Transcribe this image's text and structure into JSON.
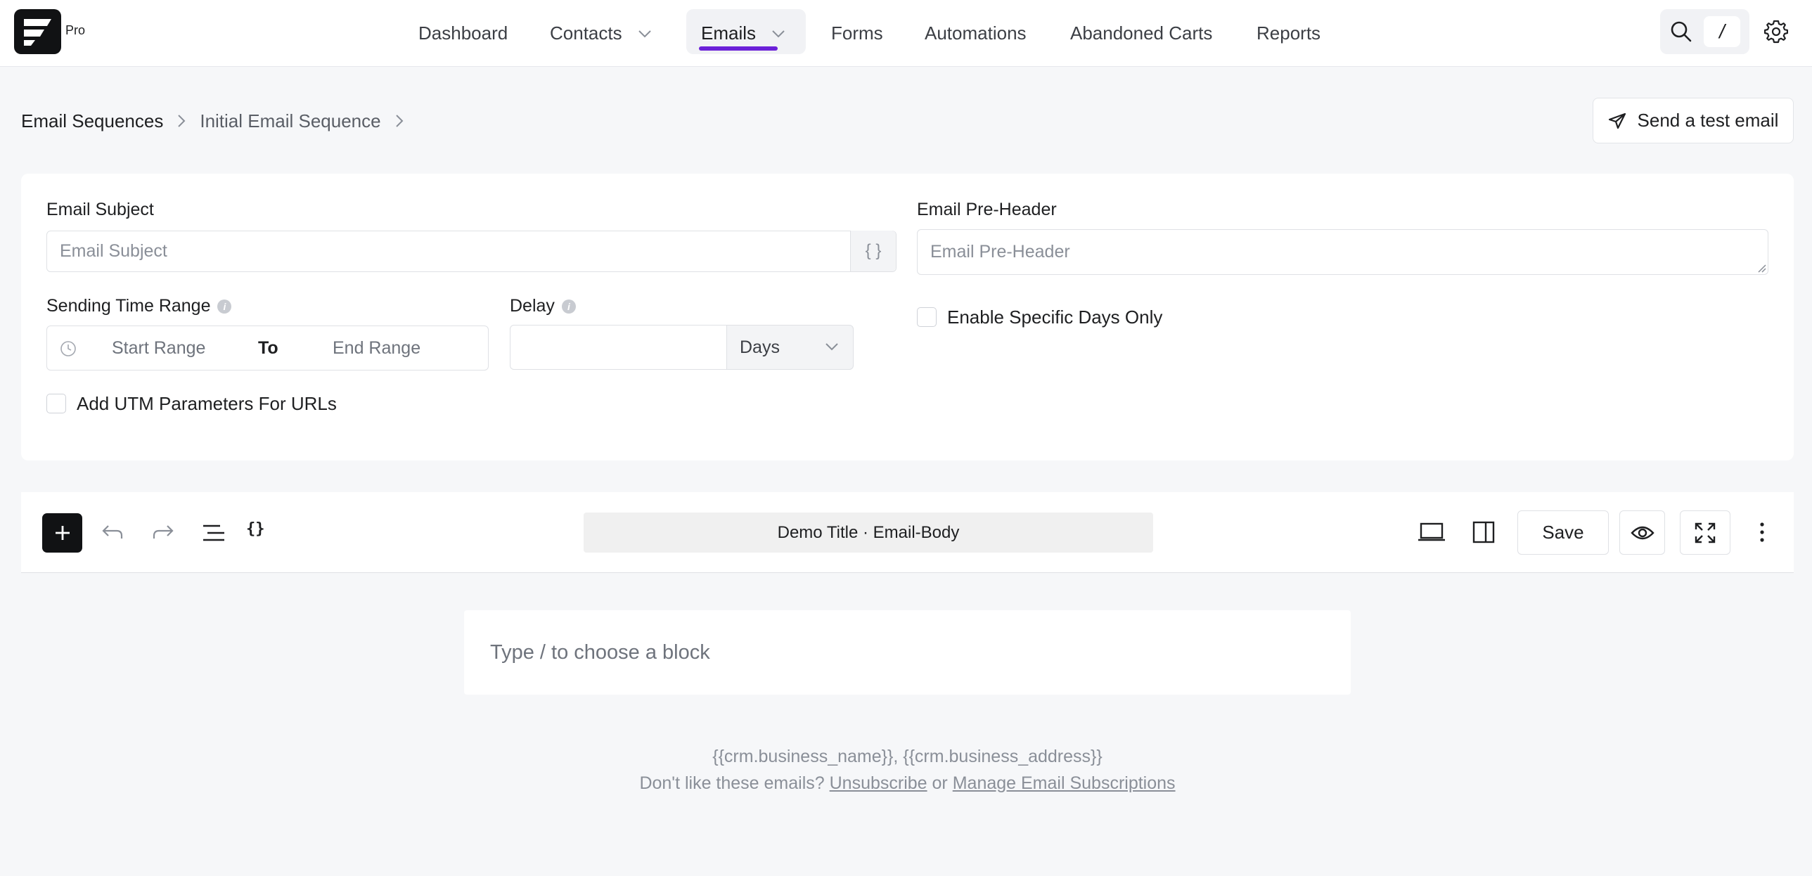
{
  "topbar": {
    "logo_badge": "Pro",
    "nav": [
      {
        "label": "Dashboard"
      },
      {
        "label": "Contacts"
      },
      {
        "label": "Emails"
      },
      {
        "label": "Forms"
      },
      {
        "label": "Automations"
      },
      {
        "label": "Abandoned Carts"
      },
      {
        "label": "Reports"
      }
    ],
    "active_nav": "Emails",
    "search_shortcut": "/",
    "accent_color": "#6b21d8"
  },
  "breadcrumb": {
    "items": [
      "Email Sequences",
      "Initial Email Sequence"
    ]
  },
  "actions": {
    "send_test_label": "Send a test email"
  },
  "settings": {
    "subject_label": "Email Subject",
    "subject_placeholder": "Email Subject",
    "brace_addon": "{ }",
    "preheader_label": "Email Pre-Header",
    "preheader_placeholder": "Email Pre-Header",
    "time_range_label": "Sending Time Range",
    "start_range": "Start Range",
    "to_label": "To",
    "end_range": "End Range",
    "delay_label": "Delay",
    "delay_value": "",
    "delay_unit": "Days",
    "specific_days_label": "Enable Specific Days Only",
    "utm_label": "Add UTM Parameters For URLs"
  },
  "editor": {
    "doc_title": "Demo Title · Email-Body",
    "save_label": "Save",
    "block_placeholder": "Type / to choose a block",
    "footer_merge_tags": "{{crm.business_name}}, {{crm.business_address}}",
    "footer_prefix": "Don't like these emails?",
    "unsubscribe_label": "Unsubscribe",
    "or_label": "or",
    "manage_label": "Manage Email Subscriptions"
  }
}
